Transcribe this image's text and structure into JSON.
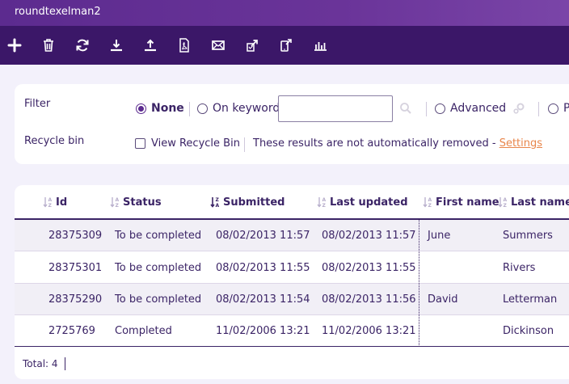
{
  "window": {
    "title": "roundtexelman2"
  },
  "toolbar": {
    "buttons": [
      {
        "icon": "plus-icon"
      },
      {
        "icon": "trash-icon"
      },
      {
        "icon": "refresh-icon"
      },
      {
        "icon": "download-icon"
      },
      {
        "icon": "upload-icon"
      },
      {
        "icon": "pdf-icon"
      },
      {
        "icon": "envelope-icon"
      },
      {
        "icon": "export-doc-icon"
      },
      {
        "icon": "mobile-export-icon"
      },
      {
        "icon": "bar-chart-icon"
      }
    ]
  },
  "filter": {
    "label": "Filter",
    "options": {
      "none": "None",
      "keyword": "On keyword",
      "advanced": "Advanced",
      "partial": "P"
    },
    "selected": "none",
    "keyword_value": ""
  },
  "recycle": {
    "label": "Recycle bin",
    "view_label": "View Recycle Bin",
    "view_checked": false,
    "note": "These results are not automatically removed - ",
    "settings_link": "Settings"
  },
  "table": {
    "columns": [
      "Id",
      "Status",
      "Submitted",
      "Last updated",
      "First name",
      "Last name"
    ],
    "active_sort_column": "Submitted",
    "rows": [
      {
        "id": "28375309",
        "status": "To be completed",
        "submitted": "08/02/2013 11:57",
        "updated": "08/02/2013 11:57",
        "first": "June",
        "last": "Summers"
      },
      {
        "id": "28375301",
        "status": "To be completed",
        "submitted": "08/02/2013 11:55",
        "updated": "08/02/2013 11:55",
        "first": "",
        "last": "Rivers"
      },
      {
        "id": "28375290",
        "status": "To be completed",
        "submitted": "08/02/2013 11:54",
        "updated": "08/02/2013 11:56",
        "first": "David",
        "last": "Letterman"
      },
      {
        "id": "2725769",
        "status": "Completed",
        "submitted": "11/02/2006 13:21",
        "updated": "11/02/2006 13:21",
        "first": "",
        "last": "Dickinson"
      }
    ],
    "total": "Total: 4"
  },
  "colors": {
    "accent": "#5c2b8f",
    "toolbar": "#3b1768",
    "text": "#3b2466",
    "link": "#e8854a"
  }
}
